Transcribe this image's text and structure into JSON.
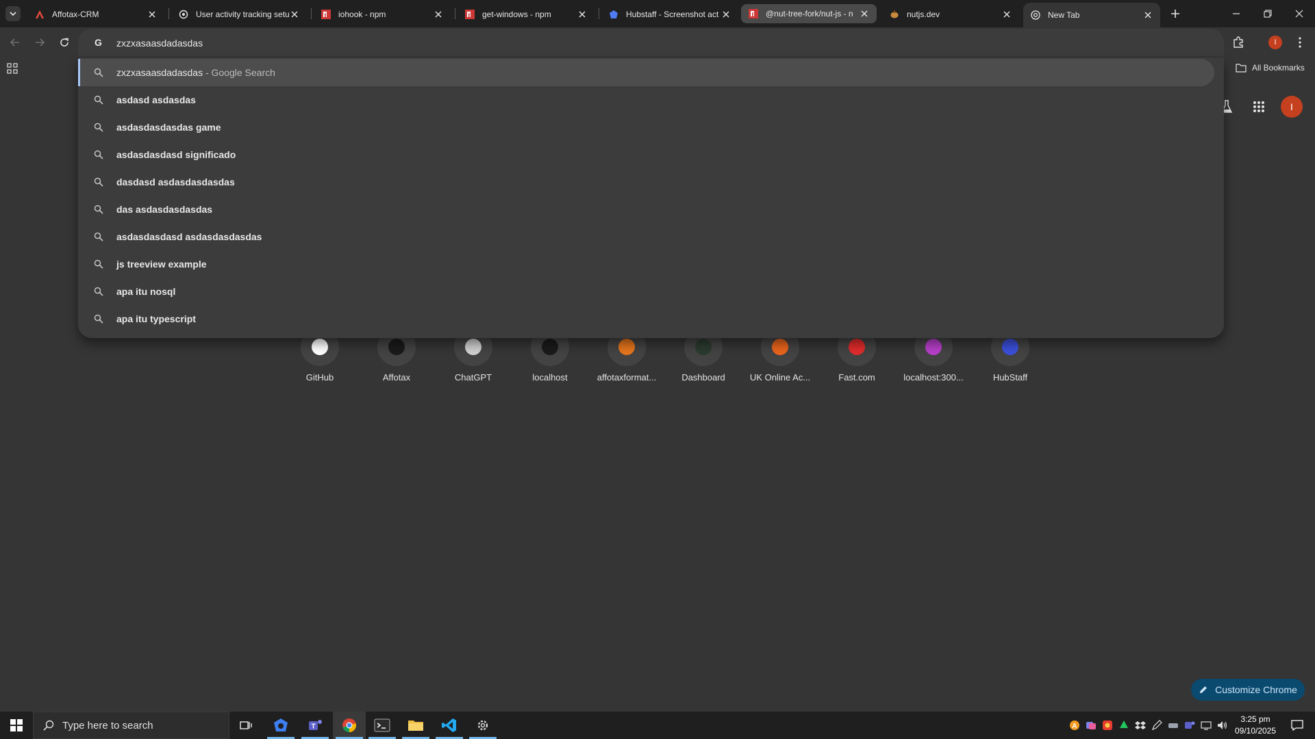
{
  "tabs": [
    {
      "title": "Affotax-CRM",
      "favicon": "affotax-icon"
    },
    {
      "title": "User activity tracking setu",
      "favicon": "chatgpt-icon"
    },
    {
      "title": "iohook - npm",
      "favicon": "npm-icon"
    },
    {
      "title": "get-windows - npm",
      "favicon": "npm-icon"
    },
    {
      "title": "Hubstaff - Screenshot act",
      "favicon": "hubstaff-icon"
    },
    {
      "title": "@nut-tree-fork/nut-js - n",
      "favicon": "npm-icon"
    },
    {
      "title": "nutjs.dev",
      "favicon": "nutjs-icon"
    },
    {
      "title": "New Tab",
      "favicon": "chrome-icon"
    }
  ],
  "omnibox": {
    "text": "zxzxasaasdadasdas",
    "suggestions": [
      {
        "text": "zxzxasaasdadasdas",
        "suffix": " - Google Search",
        "bold": false
      },
      {
        "text": "asdasd asdasdas",
        "suffix": "",
        "bold": true
      },
      {
        "text": "asdasdasdasdas game",
        "suffix": "",
        "bold": true
      },
      {
        "text": "asdasdasdasd significado",
        "suffix": "",
        "bold": true
      },
      {
        "text": "dasdasd asdasdasdasdas",
        "suffix": "",
        "bold": true
      },
      {
        "text": "das asdasdasdasdas",
        "suffix": "",
        "bold": true
      },
      {
        "text": "asdasdasdasd asdasdasdasdas",
        "suffix": "",
        "bold": true
      },
      {
        "text": "js treeview example",
        "suffix": "",
        "bold": true
      },
      {
        "text": "apa itu nosql",
        "suffix": "",
        "bold": true
      },
      {
        "text": "apa itu typescript",
        "suffix": "",
        "bold": true
      }
    ]
  },
  "profile_initial": "I",
  "bookmarks": {
    "all_bookmarks": "All Bookmarks"
  },
  "shortcuts": [
    {
      "label": "GitHub",
      "color": "#ffffff"
    },
    {
      "label": "Affotax",
      "color": "#1a1a1a"
    },
    {
      "label": "ChatGPT",
      "color": "#cfcfcf"
    },
    {
      "label": "localhost",
      "color": "#1a1a1a"
    },
    {
      "label": "affotaxformat...",
      "color": "#e3741c"
    },
    {
      "label": "Dashboard",
      "color": "#2a3a2f"
    },
    {
      "label": "UK Online Ac...",
      "color": "#e8641c"
    },
    {
      "label": "Fast.com",
      "color": "#e02b2b"
    },
    {
      "label": "localhost:300...",
      "color": "#b63fc9"
    },
    {
      "label": "HubStaff",
      "color": "#3b4fd8"
    }
  ],
  "customize_label": "Customize Chrome",
  "taskbar": {
    "search_placeholder": "Type here to search",
    "time": "3:25 pm",
    "date": "09/10/2025"
  },
  "colors": {
    "accent": "#a8c7fa",
    "profile": "#c5401f",
    "customize_bg": "#0b4a6f"
  }
}
